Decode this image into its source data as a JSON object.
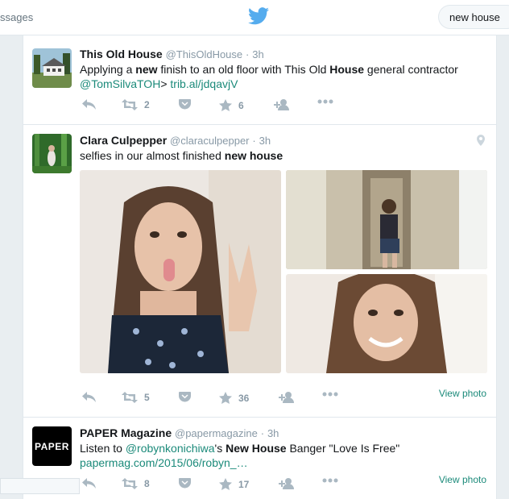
{
  "topbar": {
    "messages_label": "ssages",
    "search_value": "new house"
  },
  "tweets": [
    {
      "fullname": "This Old House",
      "handle": "@ThisOldHouse",
      "sep": "·",
      "time": "3h",
      "text_a": "Applying a ",
      "text_b": "new",
      "text_c": " finish to an old floor with This Old ",
      "text_d": "House",
      "text_e": " general contractor",
      "mention": "@TomSilvaTOH",
      "text_f": "> ",
      "link": "trib.al/jdqavjV",
      "retweets": "2",
      "likes": "6"
    },
    {
      "fullname": "Clara Culpepper",
      "handle": "@claraculpepper",
      "sep": "·",
      "time": "3h",
      "text_a": "selfies in our almost finished ",
      "text_b": "new house",
      "retweets": "5",
      "likes": "36",
      "view_photo": "View photo"
    },
    {
      "fullname": "PAPER Magazine",
      "handle": "@papermagazine",
      "sep": "·",
      "time": "3h",
      "text_a": "Listen to ",
      "mention": "@robynkonichiwa",
      "text_b": "'s ",
      "text_c": "New House",
      "text_d": " Banger \"Love Is Free\"",
      "link": "papermag.com/2015/06/robyn_…",
      "retweets": "8",
      "likes": "17",
      "view_photo": "View photo",
      "avatar_text": "PAPER"
    }
  ],
  "colors": {
    "link": "#1b8a7a",
    "twitter_blue": "#55acee",
    "action_gray": "#aab8c2"
  }
}
